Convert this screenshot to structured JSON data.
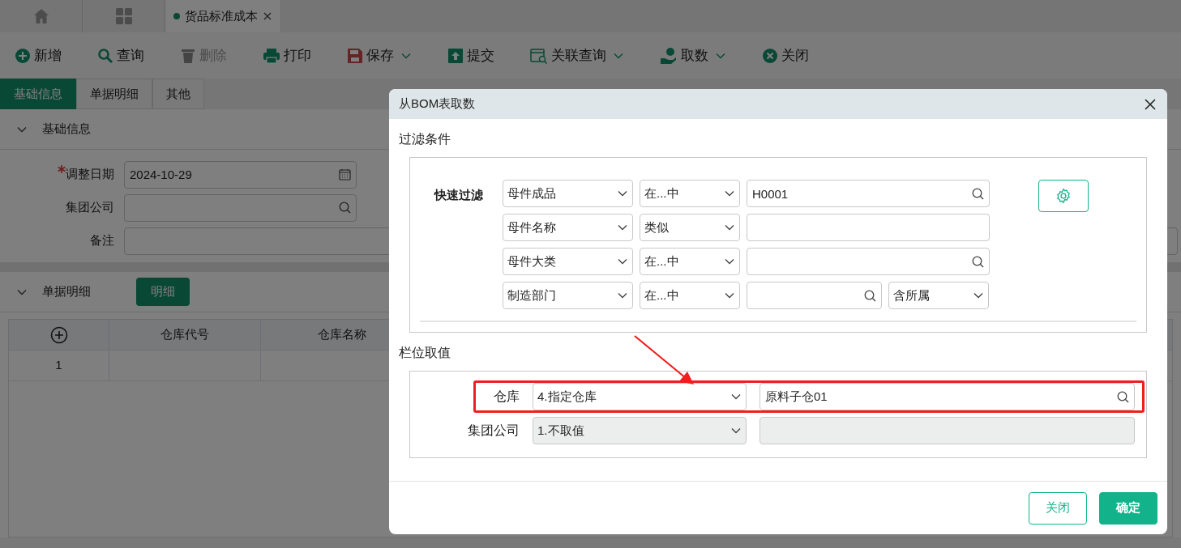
{
  "app_tabs": [
    {
      "label": "货品标准成本",
      "selected": true
    }
  ],
  "toolbar": [
    {
      "label": "新增",
      "disabled": false,
      "dropdown": false
    },
    {
      "label": "查询",
      "disabled": false,
      "dropdown": false
    },
    {
      "label": "删除",
      "disabled": true,
      "dropdown": false
    },
    {
      "label": "打印",
      "disabled": false,
      "dropdown": false
    },
    {
      "label": "保存",
      "disabled": false,
      "dropdown": true
    },
    {
      "label": "提交",
      "disabled": false,
      "dropdown": false
    },
    {
      "label": "关联查询",
      "disabled": false,
      "dropdown": true
    },
    {
      "label": "取数",
      "disabled": false,
      "dropdown": true
    },
    {
      "label": "关闭",
      "disabled": false,
      "dropdown": false
    }
  ],
  "form_tabs": [
    {
      "label": "基础信息",
      "selected": true
    },
    {
      "label": "单据明细",
      "selected": false
    },
    {
      "label": "其他",
      "selected": false
    }
  ],
  "basic_section": {
    "title": "基础信息",
    "expanded": true,
    "fields": [
      {
        "label": "调整日期",
        "required": true,
        "kind": "date",
        "value": "2024-10-29"
      },
      {
        "label": "集团公司",
        "required": false,
        "kind": "lookup"
      },
      {
        "label": "备注",
        "required": false,
        "kind": "text"
      }
    ]
  },
  "detail_section": {
    "title": "单据明细",
    "expanded": true,
    "button": "明细",
    "table": {
      "columns": [
        "仓库代号",
        "仓库名称"
      ],
      "rows": [
        {
          "row_number": "1"
        }
      ]
    }
  },
  "dialog": {
    "title": "从BOM表取数",
    "filter_title": "过滤条件",
    "quick_filter_label": "快速过滤",
    "filters": [
      {
        "field": "母件成品",
        "operator": "在...中",
        "value": "H0001",
        "lookup": true
      },
      {
        "field": "母件名称",
        "operator": "类似",
        "lookup": false
      },
      {
        "field": "母件大类",
        "operator": "在...中",
        "lookup": true
      },
      {
        "field": "制造部门",
        "operator": "在...中",
        "lookup": true,
        "scope": "含所属"
      }
    ],
    "values_title": "栏位取值",
    "value_rows": [
      {
        "label": "仓库",
        "mode": "4.指定仓库",
        "value": "原料子仓01",
        "disabled": false,
        "highlighted": true
      },
      {
        "label": "集团公司",
        "mode": "1.不取值",
        "disabled": true,
        "highlighted": false
      }
    ],
    "buttons": [
      {
        "label": "关闭",
        "kind": "secondary"
      },
      {
        "label": "确定",
        "kind": "primary"
      }
    ]
  }
}
